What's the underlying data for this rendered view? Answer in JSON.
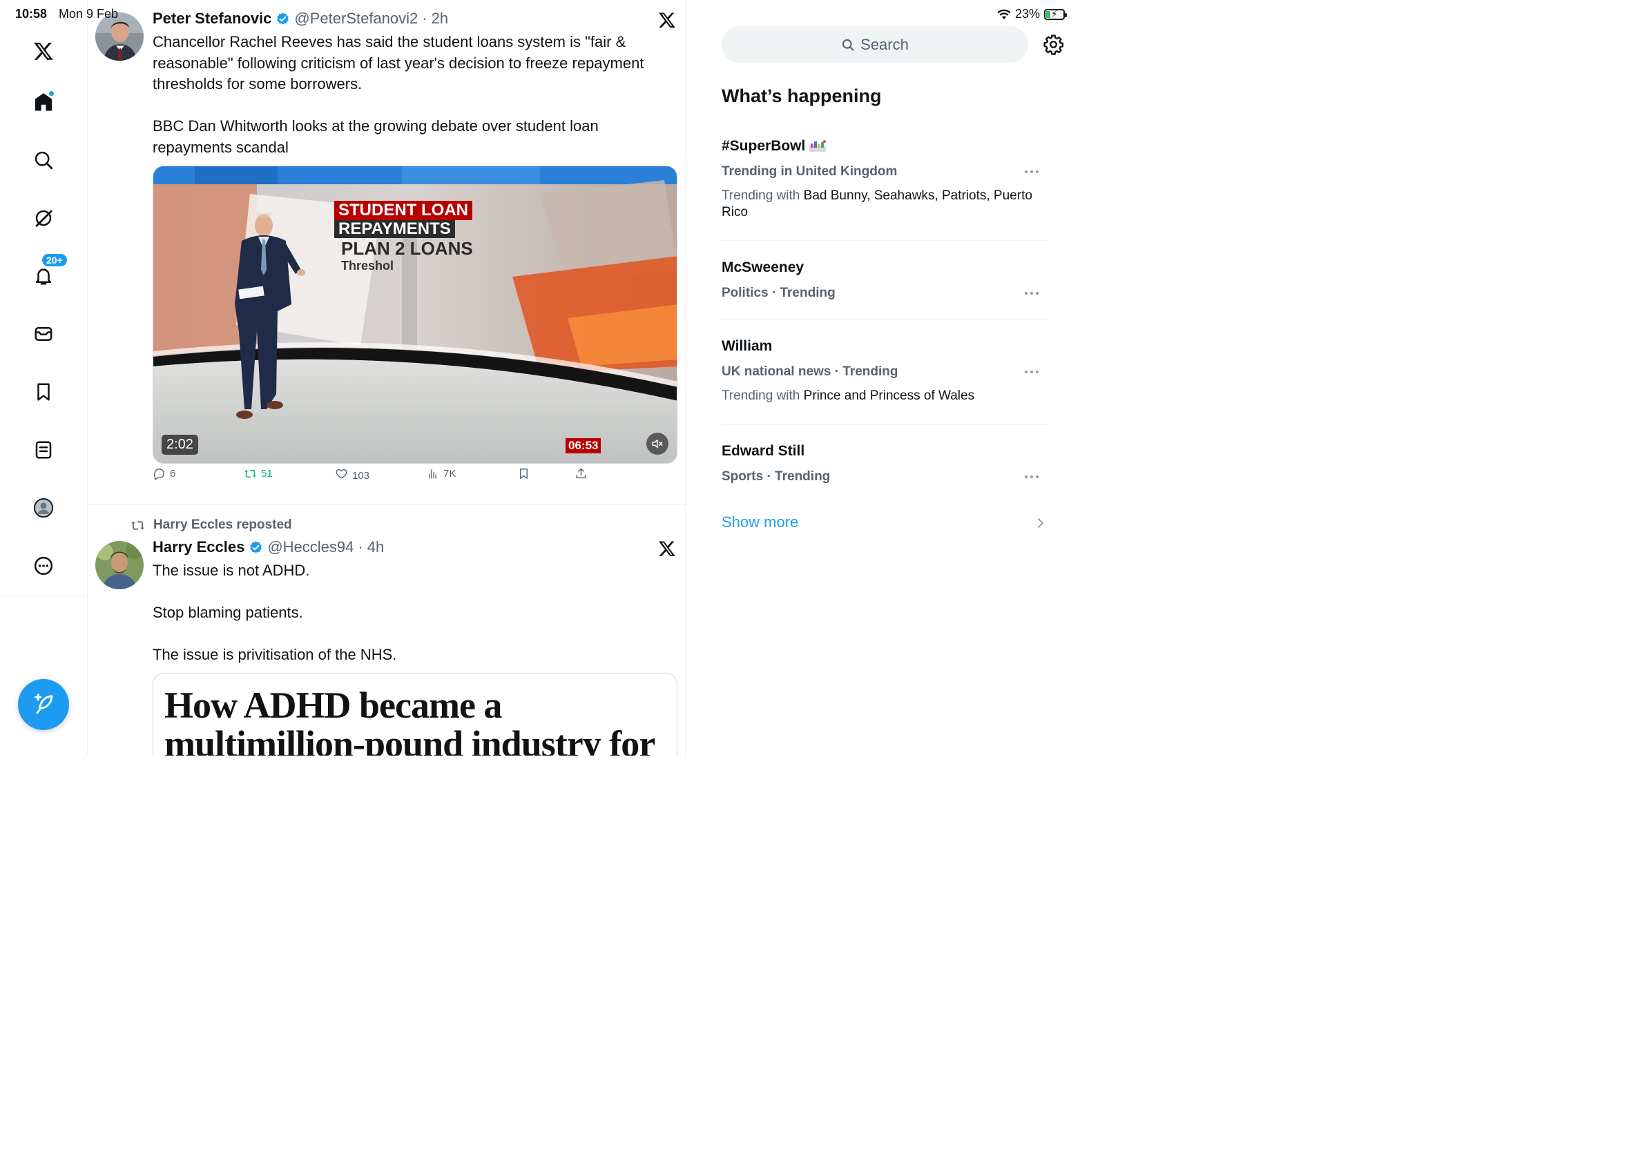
{
  "status": {
    "time": "10:58",
    "date": "Mon 9 Feb",
    "battery": "23%"
  },
  "nav": {
    "notifications_badge": "20+"
  },
  "tweets": [
    {
      "name": "Peter Stefanovic",
      "handle": "@PeterStefanovi2",
      "time": "2h",
      "text": "Chancellor Rachel Reeves has said the student loans system is \"fair &\nreasonable\" following criticism of last year's decision to freeze repayment\nthresholds for some borrowers.\n\nBBC Dan Whitworth looks at the growing debate over student loan\nrepayments scandal",
      "media": {
        "duration": "2:02",
        "graphic_line1": "STUDENT LOAN",
        "graphic_line2": "REPAYMENTS",
        "graphic_line3": "PLAN 2 LOANS",
        "graphic_line4": "Threshol",
        "bbc_clock": "06:53"
      },
      "replies": "6",
      "reposts": "51",
      "likes": "103",
      "views": "7K"
    },
    {
      "reposted_by": "Harry Eccles reposted",
      "name": "Harry Eccles",
      "handle": "@Heccles94",
      "time": "4h",
      "text": "The issue is not ADHD.\n\nStop blaming patients.\n\nThe issue is privitisation of the NHS.",
      "card_headline": "How ADHD became a multimillion-pound industry for"
    }
  ],
  "sidebar": {
    "search_placeholder": "Search",
    "section_title": "What’s happening",
    "trends": [
      {
        "name": "#SuperBowl",
        "meta": "Trending in United Kingdom",
        "with_prefix": "Trending with",
        "with_names": "Bad Bunny, Seahawks, Patriots, Puerto Rico"
      },
      {
        "name": "McSweeney",
        "meta": "Politics · Trending"
      },
      {
        "name": "William",
        "meta": "UK national news · Trending",
        "with_prefix": "Trending with",
        "with_names": "Prince and Princess of Wales"
      },
      {
        "name": "Edward Still",
        "meta": "Sports · Trending"
      }
    ],
    "show_more": "Show more"
  },
  "colors": {
    "accent": "#1d9bf0",
    "repost_green": "#00ba7c",
    "secondary_text": "#536471",
    "bbc_red": "#b80000"
  }
}
